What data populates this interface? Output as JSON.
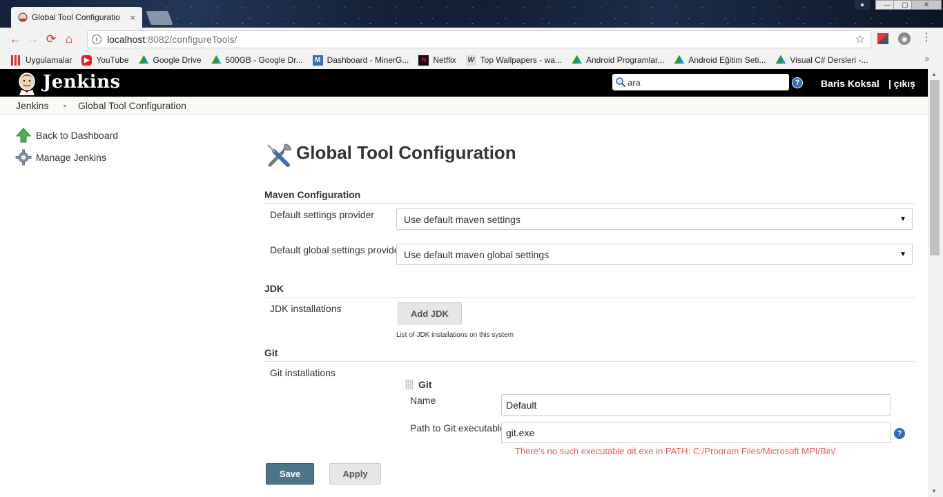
{
  "browser": {
    "tab_title": "Global Tool Configuratio",
    "tab_close": "×",
    "url_host": "localhost",
    "url_path": ":8082/configureTools/",
    "bookmarks": [
      {
        "label": "Uygulamalar",
        "icon": "apps-grid-icon"
      },
      {
        "label": "YouTube",
        "icon": "youtube-icon"
      },
      {
        "label": "Google Drive",
        "icon": "google-drive-icon"
      },
      {
        "label": "500GB - Google Dr...",
        "icon": "google-drive-icon"
      },
      {
        "label": "Dashboard - MinerG...",
        "icon": "minergate-icon"
      },
      {
        "label": "Netflix",
        "icon": "netflix-icon"
      },
      {
        "label": "Top Wallpapers - wa...",
        "icon": "wallpapers-icon"
      },
      {
        "label": "Android Programlar...",
        "icon": "google-drive-icon"
      },
      {
        "label": "Android Eğitim Seti...",
        "icon": "google-drive-icon"
      },
      {
        "label": "Visual C# Dersleri -...",
        "icon": "google-drive-icon"
      }
    ]
  },
  "header": {
    "logo_text": "Jenkins",
    "search_value": "ara",
    "help_symbol": "?",
    "user_name": "Baris Koksal",
    "logout_label": "| çıkış"
  },
  "breadcrumbs": [
    "Jenkins",
    "Global Tool Configuration"
  ],
  "sidebar": {
    "tasks": [
      {
        "label": "Back to Dashboard",
        "icon": "up-arrow-icon"
      },
      {
        "label": "Manage Jenkins",
        "icon": "gear-icon"
      }
    ]
  },
  "main": {
    "title": "Global Tool Configuration",
    "maven": {
      "heading": "Maven Configuration",
      "settings_label": "Default settings provider",
      "settings_value": "Use default maven settings",
      "global_label": "Default global settings provider",
      "global_value": "Use default maven global settings"
    },
    "jdk": {
      "heading": "JDK",
      "installations_label": "JDK installations",
      "add_button": "Add JDK",
      "hint": "List of JDK installations on this system"
    },
    "git": {
      "heading": "Git",
      "installations_label": "Git installations",
      "entry_title": "Git",
      "name_label": "Name",
      "name_value": "Default",
      "path_label": "Path to Git executable",
      "path_value": "git.exe",
      "error": "There's no such executable git.exe in PATH: C:/Program Files/Microsoft MPI/Bin/,"
    },
    "buttons": {
      "save": "Save",
      "apply": "Apply"
    }
  },
  "colors": {
    "header_bg": "#000000",
    "save_button": "#4b758b",
    "error_text": "#e35a5a",
    "help_blue": "#2d6db5"
  }
}
